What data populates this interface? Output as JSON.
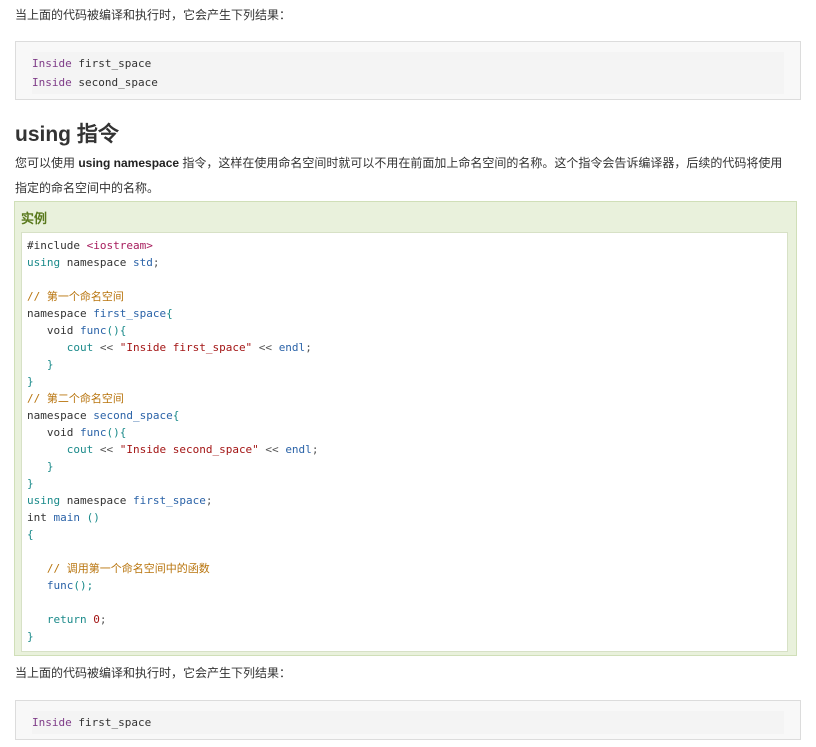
{
  "intro_text_1": "当上面的代码被编译和执行时，它会产生下列结果：",
  "output_1": [
    {
      "keyword": "Inside",
      "rest": " first_space"
    },
    {
      "keyword": "Inside",
      "rest": " second_space"
    }
  ],
  "section_title": "using 指令",
  "desc": {
    "part1": "您可以使用 ",
    "bold": "using namespace",
    "part2": " 指令，这样在使用命名空间时就可以不用在前面加上命名空间的名称。这个指令会告诉编译器，后续的代码将使用",
    "line2": "指定的命名空间中的名称。"
  },
  "example_label": "实例",
  "code": {
    "l1_a": "#include ",
    "l1_b": "<iostream>",
    "l2_a": "using",
    "l2_b": " namespace ",
    "l2_c": "std",
    "l2_d": ";",
    "l4": "// 第一个命名空间",
    "l5_a": "namespace ",
    "l5_b": "first_space",
    "l5_c": "{",
    "l6_a": "   void ",
    "l6_b": "func",
    "l6_c": "(){",
    "l7_a": "      cout ",
    "l7_b": "<<",
    "l7_c": " \"Inside first_space\"",
    "l7_d": " << ",
    "l7_e": "endl",
    "l7_f": ";",
    "l8": "   }",
    "l9": "}",
    "l10": "// 第二个命名空间",
    "l11_a": "namespace ",
    "l11_b": "second_space",
    "l11_c": "{",
    "l12_a": "   void ",
    "l12_b": "func",
    "l12_c": "(){",
    "l13_a": "      cout ",
    "l13_b": "<<",
    "l13_c": " \"Inside second_space\"",
    "l13_d": " << ",
    "l13_e": "endl",
    "l13_f": ";",
    "l14": "   }",
    "l15": "}",
    "l16_a": "using",
    "l16_b": " namespace ",
    "l16_c": "first_space",
    "l16_d": ";",
    "l17_a": "int ",
    "l17_b": "main",
    "l17_c": " ()",
    "l18": "{",
    "l20": "   // 调用第一个命名空间中的函数",
    "l21_a": "   func",
    "l21_b": "();",
    "l23_a": "   return ",
    "l23_b": "0",
    "l23_c": ";",
    "l24": "}"
  },
  "intro_text_2": "当上面的代码被编译和执行时，它会产生下列结果：",
  "output_2": [
    {
      "keyword": "Inside",
      "rest": " first_space"
    }
  ]
}
